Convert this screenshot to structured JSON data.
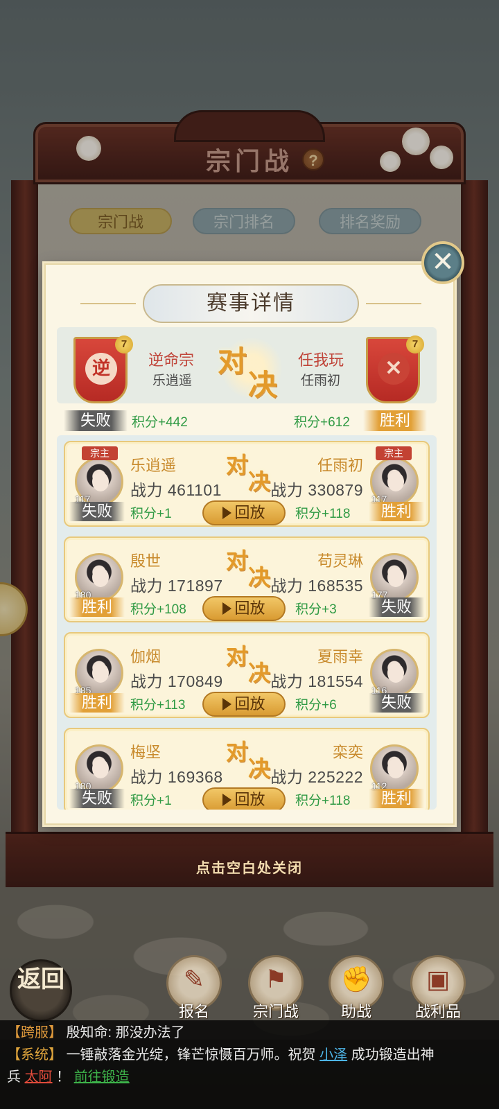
{
  "screen": {
    "title": "宗门战",
    "tabs": [
      {
        "label": "宗门战",
        "active": true
      },
      {
        "label": "宗门排名",
        "active": false
      },
      {
        "label": "排名奖励",
        "active": false
      }
    ],
    "close_hint": "点击空白处关闭"
  },
  "modal": {
    "title": "赛事详情",
    "vs_text": [
      "对",
      "决"
    ],
    "left_sect": {
      "banner_char": "逆",
      "rank": "7",
      "name": "逆命宗",
      "leader": "乐逍遥",
      "result": "失败",
      "points": "积分+442"
    },
    "right_sect": {
      "rank": "7",
      "name": "任我玩",
      "leader": "任雨初",
      "result": "胜利",
      "points": "积分+612"
    },
    "replay_label": "回放",
    "matches": [
      {
        "left": {
          "name": "乐逍遥",
          "power": "战力 461101",
          "level": "117",
          "tag": "宗主",
          "result": "失败",
          "points": "积分+1"
        },
        "right": {
          "name": "任雨初",
          "power": "战力 330879",
          "level": "117",
          "tag": "宗主",
          "result": "胜利",
          "points": "积分+118"
        }
      },
      {
        "left": {
          "name": "殷世",
          "power": "战力 171897",
          "level": "180",
          "result": "胜利",
          "points": "积分+108"
        },
        "right": {
          "name": "苟灵琳",
          "power": "战力 168535",
          "level": "177",
          "result": "失败",
          "points": "积分+3"
        }
      },
      {
        "left": {
          "name": "伽烟",
          "power": "战力 170849",
          "level": "185",
          "result": "胜利",
          "points": "积分+113"
        },
        "right": {
          "name": "夏雨幸",
          "power": "战力 181554",
          "level": "116",
          "result": "失败",
          "points": "积分+6"
        }
      },
      {
        "left": {
          "name": "梅坚",
          "power": "战力 169368",
          "level": "180",
          "result": "失败",
          "points": "积分+1"
        },
        "right": {
          "name": "栾奕",
          "power": "战力 225222",
          "level": "112",
          "result": "胜利",
          "points": "积分+118"
        }
      }
    ]
  },
  "nav": {
    "back_label": "返回",
    "items": [
      {
        "label": "报名",
        "icon": "scroll-icon"
      },
      {
        "label": "宗门战",
        "icon": "flag-mountain-icon"
      },
      {
        "label": "助战",
        "icon": "handshake-icon"
      },
      {
        "label": "战利品",
        "icon": "chest-icon"
      }
    ]
  },
  "chat": {
    "line1": {
      "channel": "【跨服】",
      "text": "殷知命: 那没办法了"
    },
    "line2": {
      "channel": "【系统】",
      "pre": "一锤敲落金光绽，锋芒惊慑百万师。祝贺",
      "player": "小泽",
      "mid": "成功锻造出神"
    },
    "line3": {
      "pre": "兵",
      "weapon": "太阿",
      "punct": "！",
      "link": "前往锻造"
    }
  },
  "colors": {
    "win": "#e2a037",
    "lose": "#5d5d5d",
    "points": "#2f9a44",
    "accent": "#c88a2c"
  }
}
